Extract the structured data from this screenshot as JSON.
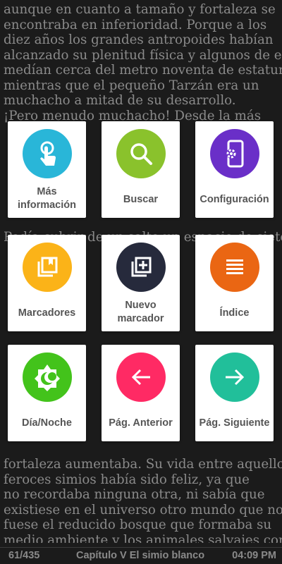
{
  "reader": {
    "lines": [
      "aunque en cuanto a tamaño y fortaleza se",
      "encontraba en inferioridad. Porque a los",
      "diez años los grandes antropoides habían",
      "alcanzado su plenitud física y algunos de ellos",
      "medían cerca del metro noventa de estatura,",
      "mientras que el pequeño Tarzán era un",
      "muchacho a mitad de su desarrollo.",
      "¡Pero menudo muchacho! Desde la más",
      "",
      "",
      "",
      "",
      "",
      "",
      "",
      "Podía cubrir de un salto un espacio de siete",
      "",
      "",
      "",
      "",
      "",
      "",
      "",
      "",
      "",
      "",
      "",
      "",
      "",
      "",
      "fortaleza aumentaba. Su vida entre aquellos",
      "feroces simios había sido feliz, ya que",
      "no recordaba ninguna otra, ni sabía que",
      "existiese en el universo otro mundo que no",
      "fuese el reducido bosque que formaba su",
      "medio ambiente y los animales salvajes con"
    ]
  },
  "menu": {
    "tiles": [
      {
        "label": "Más\ninformación",
        "icon": "touch-icon",
        "color": "#29b6d8"
      },
      {
        "label": "Buscar",
        "icon": "search-icon",
        "color": "#8ac22c"
      },
      {
        "label": "Configuración",
        "icon": "phone-settings-icon",
        "color": "#6a2fc8"
      },
      {
        "label": "Marcadores",
        "icon": "bookmarks-icon",
        "color": "#fbb318"
      },
      {
        "label": "Nuevo\nmarcador",
        "icon": "add-bookmark-icon",
        "color": "#262a3c"
      },
      {
        "label": "Índice",
        "icon": "list-icon",
        "color": "#ea6613"
      },
      {
        "label": "Día/Noche",
        "icon": "day-night-icon",
        "color": "#43c31b"
      },
      {
        "label": "Pág. Anterior",
        "icon": "arrow-left-icon",
        "color": "#ff2a64"
      },
      {
        "label": "Pág. Siguiente",
        "icon": "arrow-right-icon",
        "color": "#21bf9a"
      }
    ]
  },
  "status": {
    "page": "61/435",
    "chapter": "Capítulo V El simio blanco",
    "time": "04:09 PM"
  }
}
